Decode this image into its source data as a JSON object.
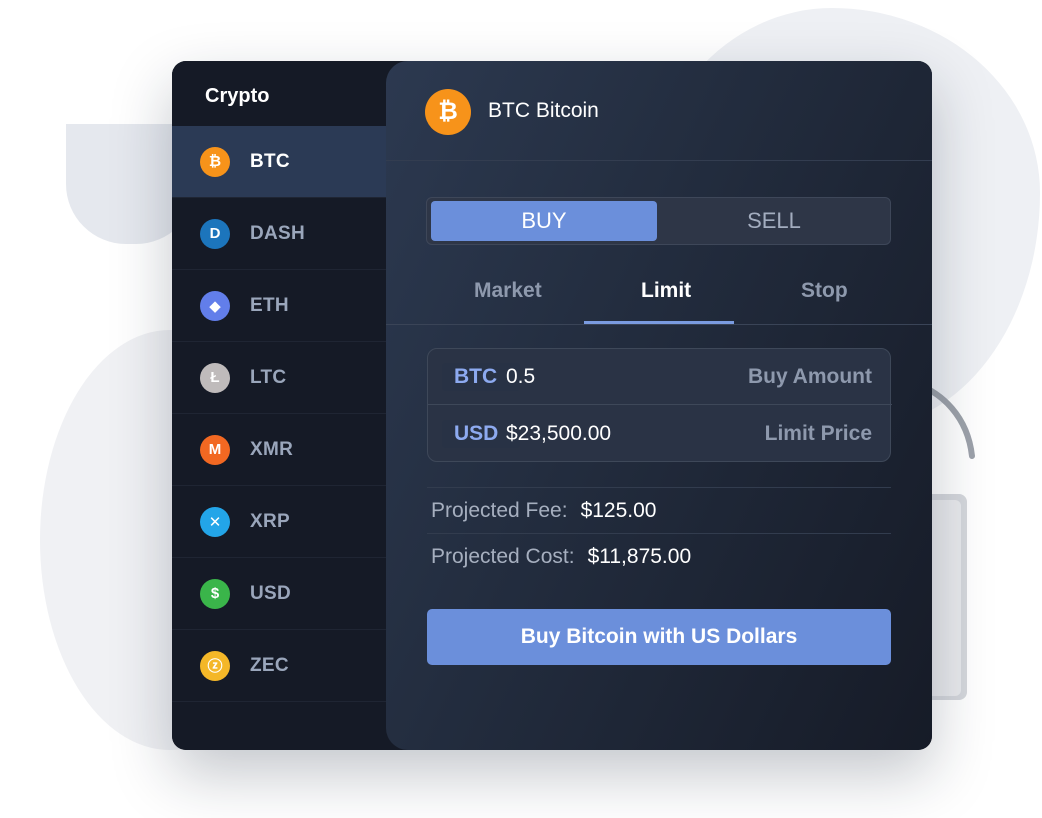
{
  "sidebar": {
    "title": "Crypto",
    "items": [
      {
        "label": "BTC",
        "icon": "bitcoin-icon",
        "glyph": "₿",
        "color": "#f7931a",
        "active": true
      },
      {
        "label": "DASH",
        "icon": "dash-icon",
        "glyph": "D",
        "color": "#1c75bc",
        "active": false
      },
      {
        "label": "ETH",
        "icon": "ethereum-icon",
        "glyph": "◆",
        "color": "#627eea",
        "active": false
      },
      {
        "label": "LTC",
        "icon": "litecoin-icon",
        "glyph": "Ł",
        "color": "#bfbbbb",
        "active": false
      },
      {
        "label": "XMR",
        "icon": "monero-icon",
        "glyph": "M",
        "color": "#f26822",
        "active": false
      },
      {
        "label": "XRP",
        "icon": "ripple-icon",
        "glyph": "✕",
        "color": "#23a5e8",
        "active": false
      },
      {
        "label": "USD",
        "icon": "dollar-icon",
        "glyph": "$",
        "color": "#3ab54a",
        "active": false
      },
      {
        "label": "ZEC",
        "icon": "zcash-icon",
        "glyph": "ⓩ",
        "color": "#f4b728",
        "active": false
      }
    ]
  },
  "header": {
    "glyph": "₿",
    "title": "BTC Bitcoin"
  },
  "toggle": {
    "buy_label": "BUY",
    "sell_label": "SELL",
    "selected": "BUY"
  },
  "tabs": {
    "market": "Market",
    "limit": "Limit",
    "stop": "Stop",
    "selected": "Limit"
  },
  "inputs": {
    "amount": {
      "currency": "BTC",
      "value": "0.5",
      "label": "Buy Amount"
    },
    "price": {
      "currency": "USD",
      "value": "$23,500.00",
      "label": "Limit Price"
    }
  },
  "summary": {
    "fee_label": "Projected Fee:",
    "fee_value": "$125.00",
    "cost_label": "Projected Cost:",
    "cost_value": "$11,875.00"
  },
  "cta_label": "Buy Bitcoin with US Dollars",
  "colors": {
    "accent": "#6b8fdb",
    "window_bg": "#141a27",
    "active_row": "#2b3a55"
  }
}
